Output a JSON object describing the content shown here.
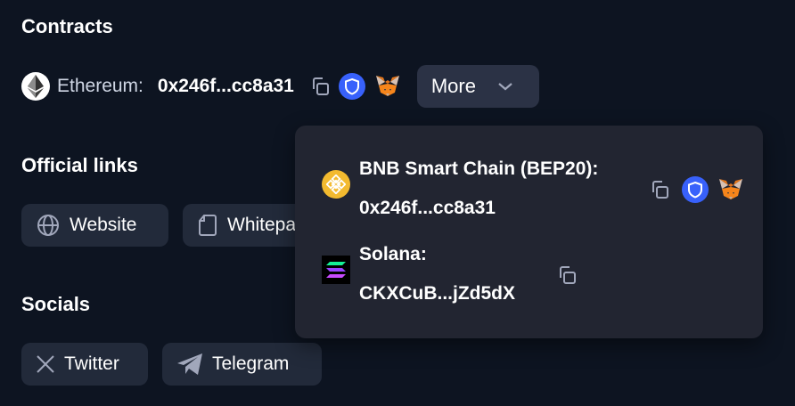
{
  "sections": {
    "contracts_title": "Contracts",
    "links_title": "Official links",
    "socials_title": "Socials"
  },
  "contract": {
    "chain": "Ethereum:",
    "address": "0x246f...cc8a31",
    "more_label": "More"
  },
  "dropdown": {
    "items": [
      {
        "chain": "BNB Smart Chain (BEP20):",
        "address": "0x246f...cc8a31",
        "icon": "bnb-logo"
      },
      {
        "chain": "Solana:",
        "address": "CKXCuB...jZd5dX",
        "icon": "solana-logo"
      }
    ]
  },
  "links": {
    "website": "Website",
    "whitepaper": "Whitepaper"
  },
  "socials": {
    "twitter": "Twitter",
    "telegram": "Telegram"
  },
  "colors": {
    "background": "#0d1421",
    "button_bg": "#222a3a",
    "more_bg": "#2b3245",
    "dropdown_bg": "#222531",
    "shield_blue": "#3861fb",
    "bnb_yellow": "#f3ba2f"
  }
}
